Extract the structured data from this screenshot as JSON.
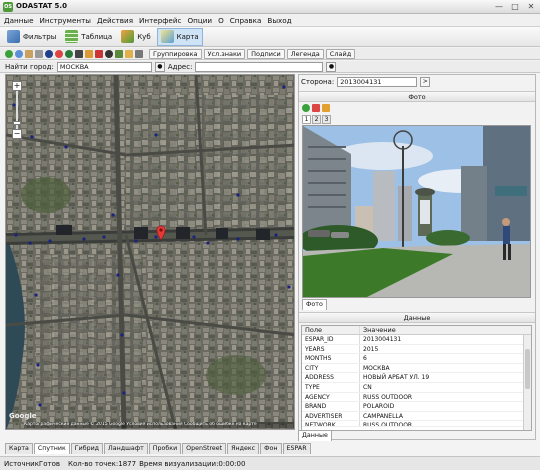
{
  "app": {
    "title": "ODASTAT 5.0",
    "logo": "OS"
  },
  "window_controls": [
    "—",
    "□",
    "✕"
  ],
  "menu": [
    "Данные",
    "Инструменты",
    "Действия",
    "Интерфейс",
    "Опции",
    "О",
    "Справка",
    "Выход"
  ],
  "toolbar": [
    {
      "label": "Фильтры",
      "icon": "filters-icon",
      "active": false
    },
    {
      "label": "Таблица",
      "icon": "table-icon",
      "active": false
    },
    {
      "label": "Куб",
      "icon": "cube-icon",
      "active": false
    },
    {
      "label": "Карта",
      "icon": "map-icon",
      "active": true
    }
  ],
  "map_tools": {
    "buttons": [
      "Группировка",
      "Усл.знаки",
      "Подписи",
      "Легенда",
      "Слайд"
    ]
  },
  "search": {
    "city_label": "Найти город:",
    "city_value": "МОСКВА",
    "address_label": "Адрес:",
    "address_value": ""
  },
  "map": {
    "google": "Google",
    "attribution": "Картографические данные © 2015 Google   Условия использования   Сообщить об ошибке на карте",
    "zoom_plus": "+",
    "zoom_minus": "−"
  },
  "map_tabs": [
    "Карта",
    "Спутник",
    "Гибрид",
    "Ландшафт",
    "Пробки",
    "OpenStreet",
    "Яндекс",
    "Фон",
    "ESPAR"
  ],
  "map_tabs_active": "Спутник",
  "status": {
    "source": "ИсточникГотов",
    "points": "Кол-во точек:1877",
    "time": "Время визуализации:0:00:00"
  },
  "side": {
    "label": "Сторона:",
    "value": "2013004131",
    "go": ">"
  },
  "photo": {
    "header": "Фото",
    "tabs": [
      "1",
      "2",
      "3"
    ],
    "bottom_tab": "Фото"
  },
  "data_section": {
    "header": "Данные",
    "col_field": "Поле",
    "col_value": "Значение",
    "rows": [
      {
        "field": "ESPAR_ID",
        "value": "2013004131"
      },
      {
        "field": "YEARS",
        "value": "2015"
      },
      {
        "field": "MONTHS",
        "value": "6"
      },
      {
        "field": "CITY",
        "value": "МОСКВА"
      },
      {
        "field": "ADDRESS",
        "value": "НОВЫЙ АРБАТ УЛ. 19"
      },
      {
        "field": "TYPE",
        "value": "CN"
      },
      {
        "field": "AGENCY",
        "value": "RUSS OUTDOOR"
      },
      {
        "field": "BRAND",
        "value": "POLAROID"
      },
      {
        "field": "ADVERTISER",
        "value": "CAMPANELLA"
      },
      {
        "field": "NETWORK",
        "value": "RUSS OUTDOOR"
      }
    ],
    "bottom_tab": "Данные"
  },
  "colors": {
    "marker": "#e53935",
    "route_dots": "#1a237e",
    "water": "#2f4a57"
  }
}
